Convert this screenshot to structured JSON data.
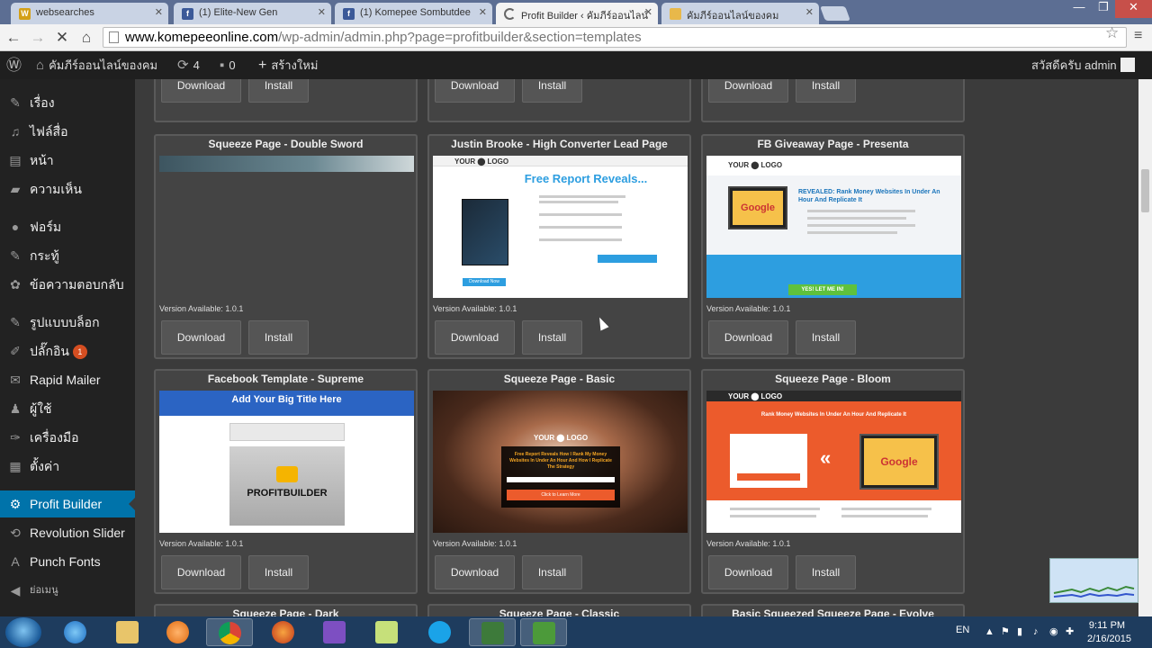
{
  "browser": {
    "tabs": [
      {
        "title": "websearches",
        "icon_color": "#d4a017",
        "icon_letter": "W"
      },
      {
        "title": "(1) Elite-New Gen",
        "icon_color": "#3b5998",
        "icon_letter": "f"
      },
      {
        "title": "(1) Komepee Sombutdee",
        "icon_color": "#3b5998",
        "icon_letter": "f"
      },
      {
        "title": "Profit Builder ‹ คัมภีร์ออนไลน์",
        "icon_color": "#ffffff",
        "icon_letter": ""
      },
      {
        "title": "คัมภีร์ออนไลน์ของคม",
        "icon_color": "#e8b84a",
        "icon_letter": ""
      }
    ],
    "url_host": "www.komepeeonline.com",
    "url_path": "/wp-admin/admin.php?page=profitbuilder&section=templates"
  },
  "adminbar": {
    "site_name": "คัมภีร์ออนไลน์ของคม",
    "updates": "4",
    "comments": "0",
    "new_label": "สร้างใหม่",
    "greeting": "สวัสดีครับ admin"
  },
  "sidebar": {
    "items": [
      {
        "label": "เรื่อง",
        "icon": "pin-icon"
      },
      {
        "label": "ไฟล์สื่อ",
        "icon": "media-icon"
      },
      {
        "label": "หน้า",
        "icon": "page-icon"
      },
      {
        "label": "ความเห็น",
        "icon": "comment-icon"
      },
      {
        "label": "ฟอร์ม",
        "icon": "form-icon"
      },
      {
        "label": "กระทู้",
        "icon": "forum-icon"
      },
      {
        "label": "ข้อความตอบกลับ",
        "icon": "reply-icon"
      },
      {
        "label": "รูปแบบบล็อก",
        "icon": "appearance-icon"
      },
      {
        "label": "ปลั๊กอิน",
        "icon": "plugin-icon",
        "badge": "1"
      },
      {
        "label": "Rapid Mailer",
        "icon": "mail-icon"
      },
      {
        "label": "ผู้ใช้",
        "icon": "user-icon"
      },
      {
        "label": "เครื่องมือ",
        "icon": "tools-icon"
      },
      {
        "label": "ตั้งค่า",
        "icon": "settings-icon"
      },
      {
        "label": "Profit Builder",
        "icon": "profit-builder-icon",
        "current": true
      },
      {
        "label": "Revolution Slider",
        "icon": "slider-icon"
      },
      {
        "label": "Punch Fonts",
        "icon": "font-icon"
      },
      {
        "label": "ย่อเมนู",
        "icon": "collapse-icon"
      }
    ]
  },
  "templates": {
    "download_label": "Download",
    "install_label": "Install",
    "version_prefix": "Version Available: ",
    "row2": [
      {
        "title": "Squeeze Page - Double Sword",
        "version": "1.0.1"
      },
      {
        "title": "Justin Brooke - High Converter Lead Page",
        "version": "1.0.1",
        "thumb": {
          "logo": "YOUR ⬤ LOGO",
          "headline": "Free Report Reveals...",
          "button": "Download Now"
        }
      },
      {
        "title": "FB Giveaway Page - Presenta",
        "version": "1.0.1",
        "thumb": {
          "logo": "YOUR ⬤ LOGO",
          "brand": "Google",
          "headline": "REVEALED: Rank Money Websites In Under An Hour And Replicate It",
          "button": "YES! LET ME IN!"
        }
      }
    ],
    "row3": [
      {
        "title": "Facebook Template - Supreme",
        "version": "1.0.1",
        "thumb": {
          "headline": "Add Your Big Title Here",
          "brand": "PROFITBUILDER"
        }
      },
      {
        "title": "Squeeze Page - Basic",
        "version": "1.0.1",
        "thumb": {
          "logo": "YOUR ⬤ LOGO",
          "headline": "Free Report Reveals How I Rank My Money Websites In Under An Hour And How I Replicate The Strategy",
          "button": "Click to Learn More"
        }
      },
      {
        "title": "Squeeze Page - Bloom",
        "version": "1.0.1",
        "thumb": {
          "logo": "YOUR ⬤ LOGO",
          "headline": "Rank Money Websites In Under An Hour And Replicate It",
          "brand": "Google"
        }
      }
    ],
    "row4": [
      {
        "title": "Squeeze Page - Dark"
      },
      {
        "title": "Squeeze Page - Classic"
      },
      {
        "title": "Basic Squeezed Squeeze Page - Evolve"
      }
    ]
  },
  "taskbar": {
    "lang": "EN",
    "time": "9:11 PM",
    "date": "2/16/2015"
  },
  "colors": {
    "wp_blue": "#0073aa",
    "taskbar": "#1e3c5e",
    "accent_blue": "#2d9ee0",
    "accent_orange": "#ec5b2c"
  }
}
